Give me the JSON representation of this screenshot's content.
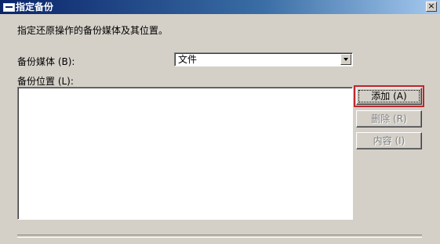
{
  "window": {
    "title": "指定备份",
    "close_label": "×"
  },
  "dialog": {
    "instruction": "指定还原操作的备份媒体及其位置。",
    "media_label": "备份媒体 (B):",
    "media_selected": "文件",
    "location_label": "备份位置 (L):",
    "locations": []
  },
  "buttons": {
    "add": "添加 (A)",
    "remove": "删除 (R)",
    "properties": "内容 (I)"
  },
  "colors": {
    "highlight": "#c1272d",
    "titlebar": "#0a246a",
    "face": "#d4d0c8"
  }
}
